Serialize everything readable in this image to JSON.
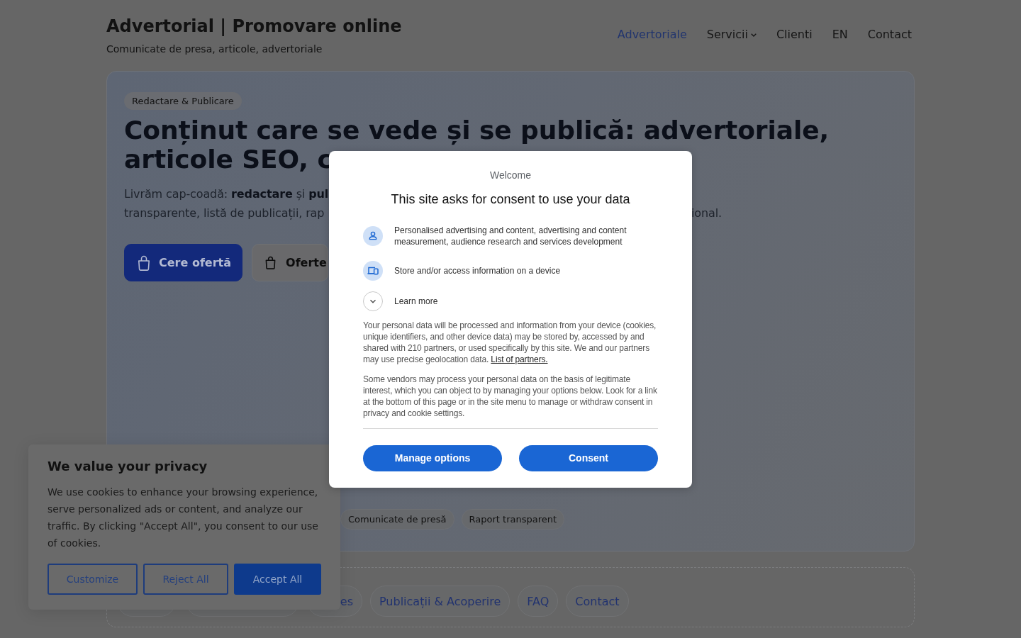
{
  "header": {
    "title": "Advertorial | Promovare online",
    "tagline": "Comunicate de presa, articole, advertoriale",
    "nav": [
      {
        "label": "Advertoriale",
        "selected": true,
        "has_submenu": false
      },
      {
        "label": "Servicii",
        "selected": false,
        "has_submenu": true
      },
      {
        "label": "Clienti",
        "selected": false,
        "has_submenu": false
      },
      {
        "label": "EN",
        "selected": false,
        "has_submenu": false
      },
      {
        "label": "Contact",
        "selected": false,
        "has_submenu": false
      }
    ]
  },
  "hero": {
    "badge": "Redactare & Publicare",
    "heading": "Conținut care se vede și se publică: advertoriale, articole SEO, c",
    "lead_lines": [
      "Livrăm cap-coadă: **redactare** și **pul**",
      "transparente, listă de publicații, rap"
    ],
    "lead_tail": "ional.",
    "buttons": [
      {
        "label": "Cere ofertă",
        "kind": "primary"
      },
      {
        "label": "Oferte",
        "kind": "secondary"
      }
    ],
    "tags": [
      "Comunicate de presă",
      "Raport transparent"
    ]
  },
  "section_nav": {
    "pills": [
      {
        "kind": "covered"
      },
      {
        "kind": "covered"
      },
      {
        "kind": "partial",
        "label": "es"
      },
      {
        "kind": "link",
        "label": "Publicații & Acoperire"
      },
      {
        "kind": "link",
        "label": "FAQ"
      },
      {
        "kind": "link",
        "label": "Contact"
      }
    ]
  },
  "cookie_banner": {
    "title": "We value your privacy",
    "text": "We use cookies to enhance your browsing experience, serve personalized ads or content, and analyze our traffic. By clicking \"Accept All\", you consent to our use of cookies.",
    "buttons": [
      {
        "label": "Customize",
        "kind": "outline"
      },
      {
        "label": "Reject All",
        "kind": "outline"
      },
      {
        "label": "Accept All",
        "kind": "filled"
      }
    ]
  },
  "consent_dialog": {
    "welcome": "Welcome",
    "title": "This site asks for consent to use your data",
    "purposes": [
      "Personalised advertising and content, advertising and content measurement, audience research and services development",
      "Store and/or access information on a device"
    ],
    "learn_more": {
      "label": "Learn more",
      "expanded": false
    },
    "notices": [
      {
        "text": "Your personal data will be processed and information from your device (cookies, unique identifiers, and other device data) may be stored by, accessed by and shared with 210 partners, or used specifically by this site. We and our partners may use precise geolocation data.",
        "link": "List of partners."
      },
      {
        "text": "Some vendors may process your personal data on the basis of legitimate interest, which you can object to by managing your options below. Look for a link at the bottom of this page or in the site menu to manage or withdraw consent in privacy and cookie settings."
      }
    ],
    "buttons": [
      "Manage options",
      "Consent"
    ]
  }
}
